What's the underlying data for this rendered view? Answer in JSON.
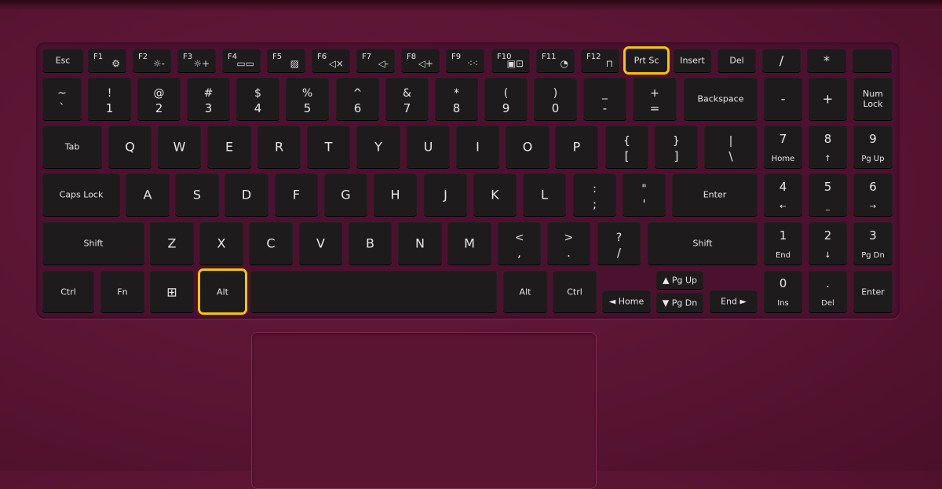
{
  "highlight_color": "#f7c600",
  "rows": [
    [
      {
        "label": "Esc"
      },
      {
        "fn": "F1",
        "icon": "settings-icon"
      },
      {
        "fn": "F2",
        "icon": "brightness-down-icon"
      },
      {
        "fn": "F3",
        "icon": "brightness-up-icon"
      },
      {
        "fn": "F4",
        "icon": "display-switch-icon"
      },
      {
        "fn": "F5",
        "icon": "touchpad-off-icon"
      },
      {
        "fn": "F6",
        "icon": "mute-icon"
      },
      {
        "fn": "F7",
        "icon": "volume-down-icon"
      },
      {
        "fn": "F8",
        "icon": "volume-up-icon"
      },
      {
        "fn": "F9",
        "icon": "keyboard-backlight-icon"
      },
      {
        "fn": "F10",
        "icon": "camera-lock-icon"
      },
      {
        "fn": "F11",
        "icon": "performance-icon"
      },
      {
        "fn": "F12",
        "icon": "fn-lock-icon"
      },
      {
        "label": "Prt Sc",
        "highlighted": true
      },
      {
        "label": "Insert"
      },
      {
        "label": "Del"
      },
      {
        "label": "/",
        "big": true
      },
      {
        "label": "*",
        "big": true
      },
      {
        "label": ""
      }
    ],
    [
      {
        "top": "~",
        "bottom": "`"
      },
      {
        "top": "!",
        "bottom": "1"
      },
      {
        "top": "@",
        "bottom": "2"
      },
      {
        "top": "#",
        "bottom": "3"
      },
      {
        "top": "$",
        "bottom": "4"
      },
      {
        "top": "%",
        "bottom": "5"
      },
      {
        "top": "^",
        "bottom": "6"
      },
      {
        "top": "&",
        "bottom": "7"
      },
      {
        "top": "*",
        "bottom": "8"
      },
      {
        "top": "(",
        "bottom": "9"
      },
      {
        "top": ")",
        "bottom": "0"
      },
      {
        "top": "_",
        "bottom": "-"
      },
      {
        "top": "+",
        "bottom": "="
      },
      {
        "label": "Backspace"
      },
      {
        "label": "-",
        "big": true
      },
      {
        "label": "+",
        "big": true
      },
      {
        "label": "Num\nLock"
      }
    ],
    [
      {
        "label": "Tab"
      },
      {
        "label": "Q",
        "big": true
      },
      {
        "label": "W",
        "big": true
      },
      {
        "label": "E",
        "big": true
      },
      {
        "label": "R",
        "big": true
      },
      {
        "label": "T",
        "big": true
      },
      {
        "label": "Y",
        "big": true
      },
      {
        "label": "U",
        "big": true
      },
      {
        "label": "I",
        "big": true
      },
      {
        "label": "O",
        "big": true
      },
      {
        "label": "P",
        "big": true
      },
      {
        "top": "{",
        "bottom": "["
      },
      {
        "top": "}",
        "bottom": "]"
      },
      {
        "top": "|",
        "bottom": "\\"
      },
      {
        "num": "7",
        "sub": "Home"
      },
      {
        "num": "8",
        "sub": "↑"
      },
      {
        "num": "9",
        "sub": "Pg Up"
      }
    ],
    [
      {
        "label": "Caps Lock"
      },
      {
        "label": "A",
        "big": true
      },
      {
        "label": "S",
        "big": true
      },
      {
        "label": "D",
        "big": true
      },
      {
        "label": "F",
        "big": true
      },
      {
        "label": "G",
        "big": true
      },
      {
        "label": "H",
        "big": true
      },
      {
        "label": "J",
        "big": true
      },
      {
        "label": "K",
        "big": true
      },
      {
        "label": "L",
        "big": true
      },
      {
        "top": ":",
        "bottom": ";"
      },
      {
        "top": "\"",
        "bottom": "'"
      },
      {
        "label": "Enter"
      },
      {
        "num": "4",
        "sub": "←"
      },
      {
        "num": "5",
        "sub": "_"
      },
      {
        "num": "6",
        "sub": "→"
      }
    ],
    [
      {
        "label": "Shift"
      },
      {
        "label": "Z",
        "big": true
      },
      {
        "label": "X",
        "big": true
      },
      {
        "label": "C",
        "big": true
      },
      {
        "label": "V",
        "big": true
      },
      {
        "label": "B",
        "big": true
      },
      {
        "label": "N",
        "big": true
      },
      {
        "label": "M",
        "big": true
      },
      {
        "top": "<",
        "bottom": ","
      },
      {
        "top": ">",
        "bottom": "."
      },
      {
        "top": "?",
        "bottom": "/"
      },
      {
        "label": "Shift"
      },
      {
        "num": "1",
        "sub": "End"
      },
      {
        "num": "2",
        "sub": "↓"
      },
      {
        "num": "3",
        "sub": "Pg Dn"
      }
    ],
    [
      {
        "label": "Ctrl"
      },
      {
        "label": "Fn"
      },
      {
        "label": "",
        "icon": "windows-icon"
      },
      {
        "label": "Alt",
        "highlighted": true
      },
      {
        "label": ""
      },
      {
        "label": "Alt"
      },
      {
        "label": "Ctrl"
      },
      {
        "label": "◄ Home"
      },
      {
        "label": "▲ Pg Up"
      },
      {
        "label": "▼ Pg Dn"
      },
      {
        "label": "End ►"
      },
      {
        "num": "0",
        "sub": "Ins"
      },
      {
        "num": ".",
        "sub": "Del"
      },
      {
        "label": "Enter"
      }
    ]
  ]
}
